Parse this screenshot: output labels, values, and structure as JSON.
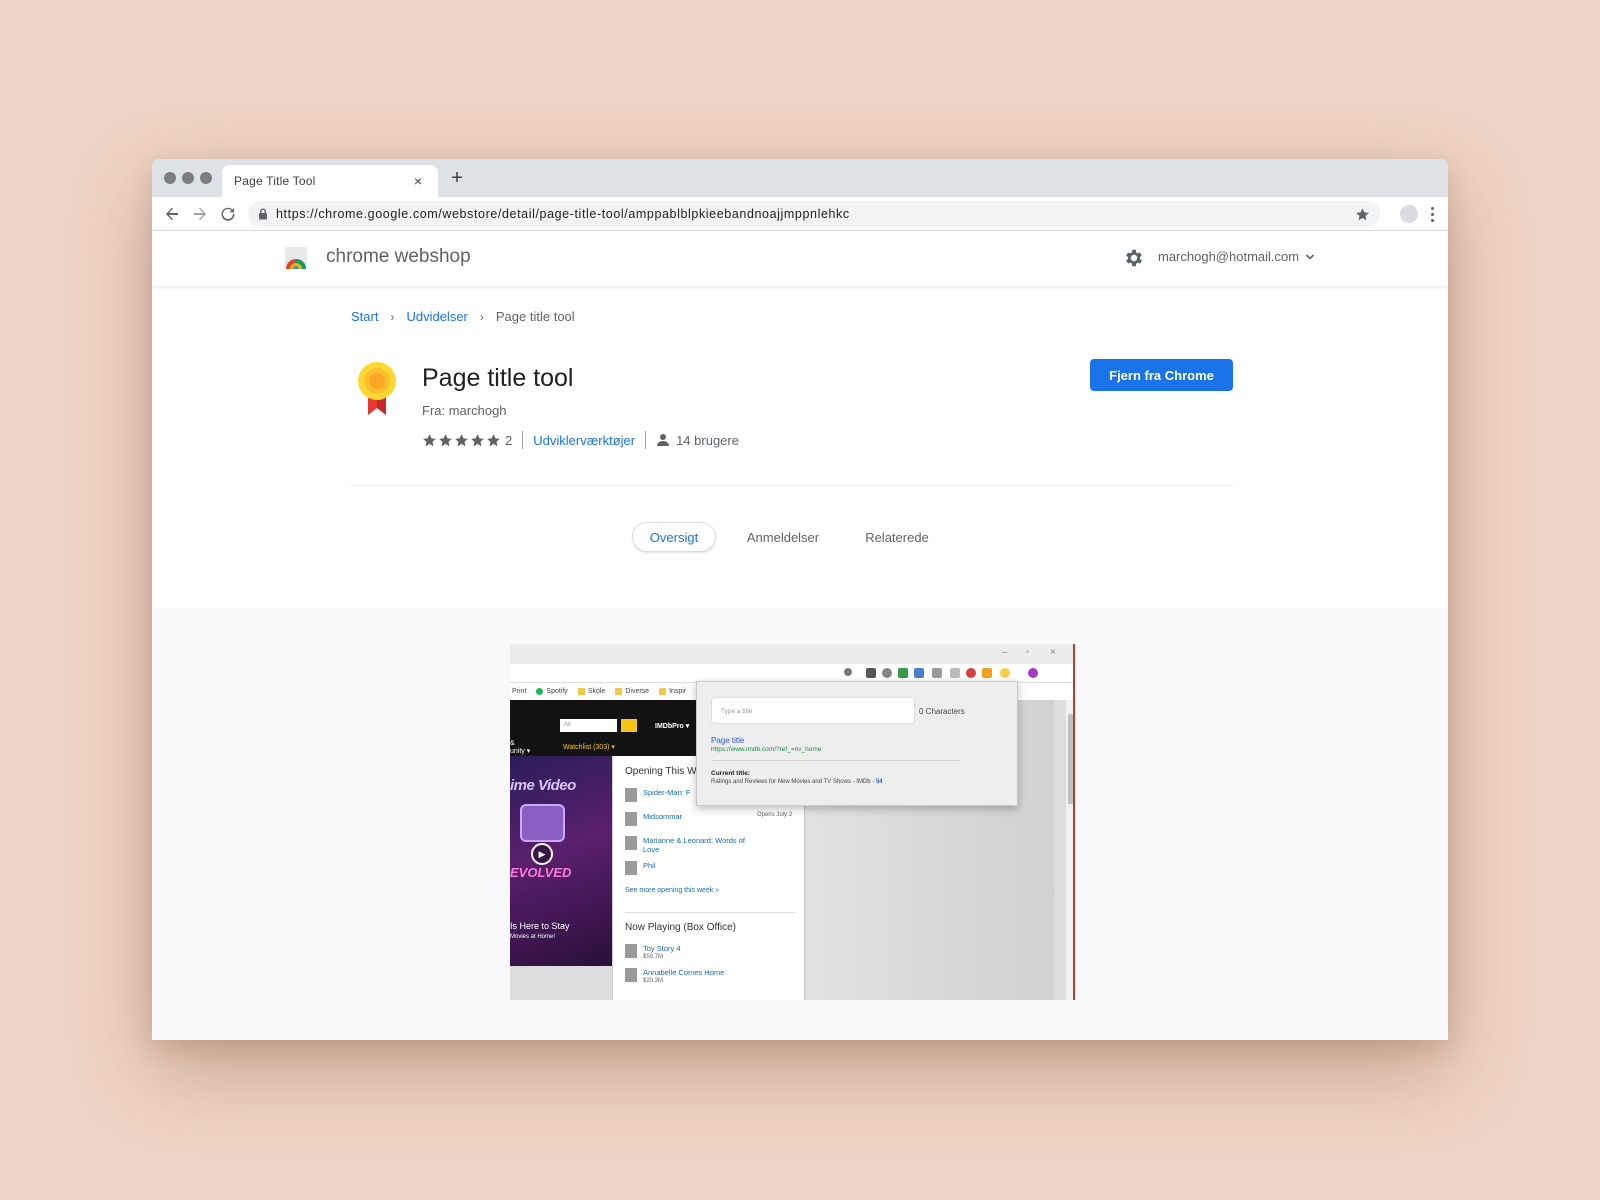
{
  "browser": {
    "tab_title": "Page Title Tool",
    "tab_close": "×",
    "new_tab": "+",
    "url": "https://chrome.google.com/webstore/detail/page-title-tool/amppablblpkieebandnoajjmppnlehkc"
  },
  "store": {
    "name": "chrome webshop",
    "account": "marchogh@hotmail.com"
  },
  "breadcrumb": {
    "start": "Start",
    "category": "Udvidelser",
    "current": "Page title tool"
  },
  "extension": {
    "title": "Page title tool",
    "author": "Fra: marchogh",
    "rating": 5,
    "rating_count": "2",
    "category": "Udviklerværktøjer",
    "users": "14 brugere",
    "remove_button": "Fjern fra Chrome"
  },
  "tabs": {
    "overview": "Oversigt",
    "reviews": "Anmeldelser",
    "related": "Relaterede"
  },
  "screenshot": {
    "bookmarks": [
      "Print",
      "Spotify",
      "Skole",
      "Diverse",
      "Inspir"
    ],
    "search_placeholder": "All",
    "imdbpro": "IMDbPro ▾",
    "watchlist": "Watchlist (303)  ▾",
    "community": "&\nunity  ▾",
    "hero_top": "ime Video",
    "hero_bottom": "EVOLVED",
    "hero_caption": "Is Here to Stay",
    "hero_caption_small": "Movies at Home!",
    "opening_heading": "Opening This W",
    "opening_items": [
      {
        "title": "Spider-Man: F",
        "sub": ""
      },
      {
        "title": "Midsommar",
        "sub": ""
      },
      {
        "title": "Marianne & Leonard: Words of Love",
        "sub": ""
      },
      {
        "title": "Phil",
        "sub": ""
      }
    ],
    "opens_label": "Opens July 3",
    "see_more": "See more opening this week »",
    "now_playing_heading": "Now Playing (Box Office)",
    "now_playing_items": [
      {
        "title": "Toy Story 4",
        "sub": "$59.7M"
      },
      {
        "title": "Annabelle Comes Home",
        "sub": "$20.3M"
      }
    ],
    "popup": {
      "placeholder": "Type a title",
      "characters": "0 Characters",
      "page_title": "Page title",
      "page_url": "https://www.imdb.com/?ref_=nv_home",
      "current_label": "Current title:",
      "current_value": "Ratings and Reviews for New Movies and TV Shows - IMDb - ",
      "current_count": "54"
    }
  },
  "colors": {
    "background": "#efd5c5",
    "accent": "#1a73e8",
    "text_grey": "#5f6368"
  }
}
